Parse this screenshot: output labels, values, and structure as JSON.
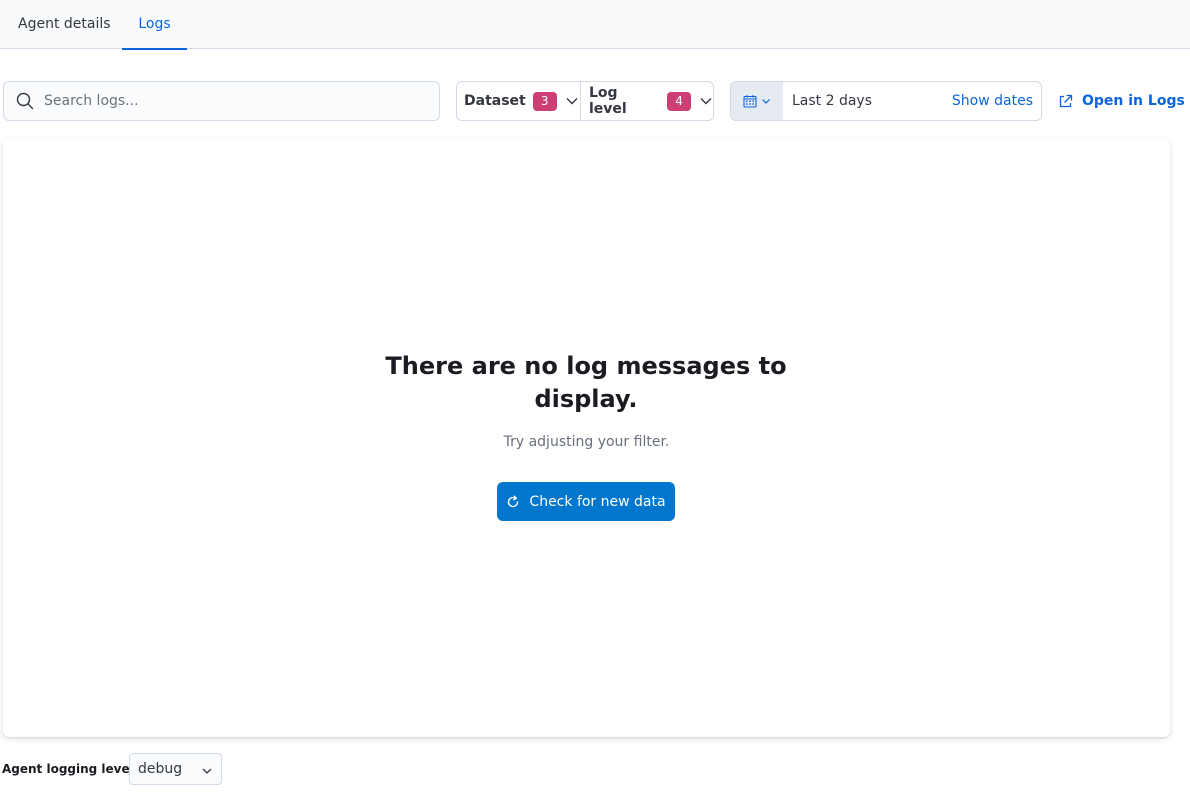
{
  "tabs": [
    {
      "label": "Agent details",
      "selected": false
    },
    {
      "label": "Logs",
      "selected": true
    }
  ],
  "search": {
    "placeholder": "Search logs...",
    "value": "",
    "icon": "search-icon"
  },
  "filters": {
    "dataset": {
      "label": "Dataset",
      "count": "3"
    },
    "log_level": {
      "label": "Log level",
      "count": "4"
    }
  },
  "date_picker": {
    "quick_menu_icon": "calendar-icon",
    "range": "Last 2 days",
    "show_dates_label": "Show dates"
  },
  "open_in_logs": {
    "label": "Open in Logs",
    "icon": "external-link-icon"
  },
  "empty_state": {
    "title": "There are no log messages to display.",
    "body": "Try adjusting your filter.",
    "button_label": "Check for new data",
    "button_icon": "refresh-icon"
  },
  "agent_logging_level": {
    "label": "Agent logging level",
    "value": "debug"
  },
  "colors": {
    "accent": "#0b64dd",
    "primary_button": "#0077cc",
    "badge": "#cc3f74",
    "border": "#d3dae6"
  }
}
